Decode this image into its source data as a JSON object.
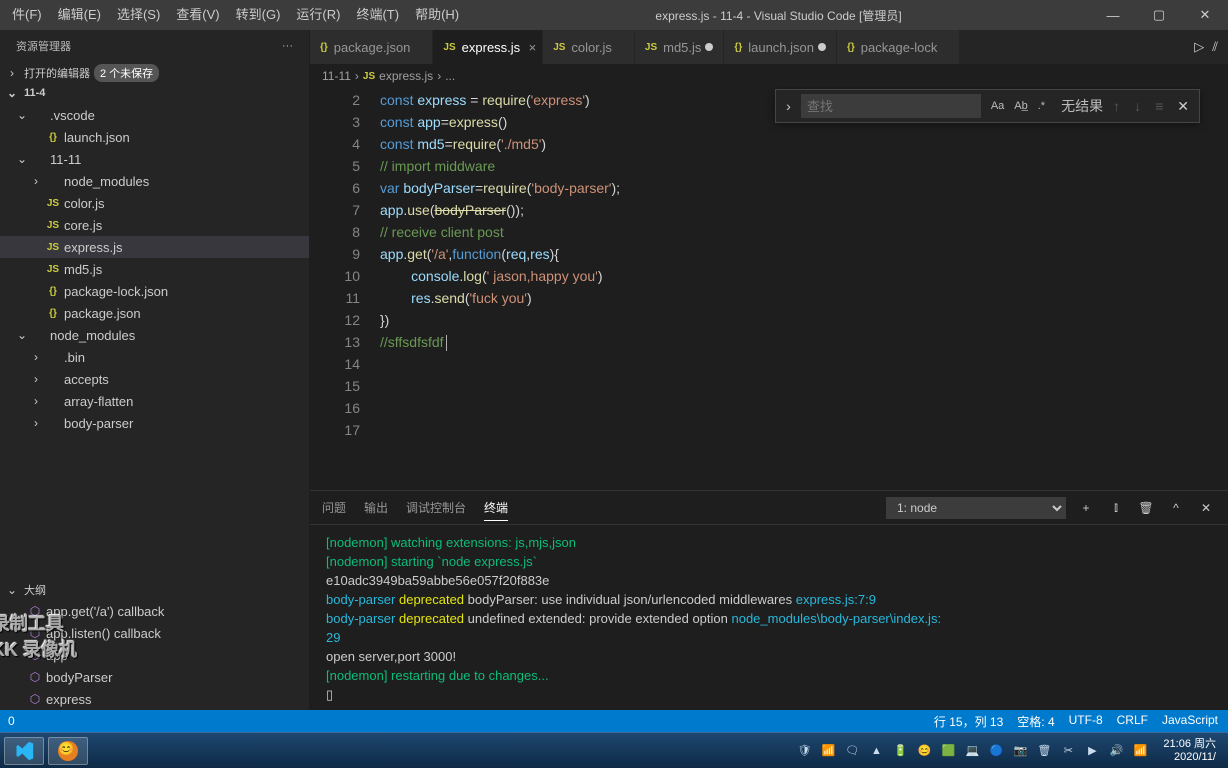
{
  "menu": [
    "件(F)",
    "编辑(E)",
    "选择(S)",
    "查看(V)",
    "转到(G)",
    "运行(R)",
    "终端(T)",
    "帮助(H)"
  ],
  "title": "express.js - 11-4 - Visual Studio Code [管理员]",
  "sidebar": {
    "header": "资源管理器",
    "openEditors": "打开的编辑器",
    "unsaved": "2 个未保存",
    "root": "11-4",
    "outline": "大纲",
    "tree": [
      {
        "t": "folder",
        "label": ".vscode",
        "chev": "v",
        "depth": 1
      },
      {
        "t": "json",
        "label": "launch.json",
        "depth": 2
      },
      {
        "t": "folder",
        "label": "11-11",
        "chev": "v",
        "depth": 1
      },
      {
        "t": "plain",
        "label": "node_modules",
        "chev": ">",
        "depth": 2
      },
      {
        "t": "js",
        "label": "color.js",
        "depth": 2
      },
      {
        "t": "js",
        "label": "core.js",
        "depth": 2
      },
      {
        "t": "js",
        "label": "express.js",
        "depth": 2,
        "active": true
      },
      {
        "t": "js",
        "label": "md5.js",
        "depth": 2
      },
      {
        "t": "json",
        "label": "package-lock.json",
        "depth": 2
      },
      {
        "t": "json",
        "label": "package.json",
        "depth": 2
      },
      {
        "t": "folder",
        "label": "node_modules",
        "chev": "v",
        "depth": 1
      },
      {
        "t": "plain",
        "label": ".bin",
        "chev": ">",
        "depth": 2
      },
      {
        "t": "plain",
        "label": "accepts",
        "chev": ">",
        "depth": 2
      },
      {
        "t": "plain",
        "label": "array-flatten",
        "chev": ">",
        "depth": 2
      },
      {
        "t": "plain",
        "label": "body-parser",
        "chev": ">",
        "depth": 2
      }
    ],
    "outlineItems": [
      {
        "label": "app.get('/a') callback"
      },
      {
        "label": "app.listen() callback"
      },
      {
        "label": "app"
      },
      {
        "label": "bodyParser"
      },
      {
        "label": "express"
      }
    ]
  },
  "tabs": [
    {
      "icon": "{}",
      "label": "package.json",
      "cls": "yellow"
    },
    {
      "icon": "JS",
      "label": "express.js",
      "cls": "yellow",
      "active": true,
      "close": true
    },
    {
      "icon": "JS",
      "label": "color.js",
      "cls": "yellow"
    },
    {
      "icon": "JS",
      "label": "md5.js",
      "cls": "yellow",
      "dirty": true
    },
    {
      "icon": "{}",
      "label": "launch.json",
      "cls": "yellow",
      "dirty": true
    },
    {
      "icon": "{}",
      "label": "package-lock",
      "cls": "yellow"
    }
  ],
  "breadcrumb": {
    "folder": "11-11",
    "file": "express.js",
    "fileIcon": "JS",
    "more": "..."
  },
  "find": {
    "placeholder": "查找",
    "noResult": "无结果",
    "opts": [
      "Aa",
      "Ab̲",
      ".*"
    ]
  },
  "code": {
    "start": 2,
    "lines": [
      [
        [
          "c-kw",
          "const "
        ],
        [
          "c-var",
          "express"
        ],
        [
          "",
          " = "
        ],
        [
          "c-fn",
          "require"
        ],
        [
          "",
          "("
        ],
        [
          "c-str",
          "'express'"
        ],
        [
          "",
          ")"
        ]
      ],
      [
        [
          "c-kw",
          "const "
        ],
        [
          "c-var",
          "app"
        ],
        [
          "",
          "="
        ],
        [
          "c-fn",
          "express"
        ],
        [
          "",
          "()"
        ]
      ],
      [
        [
          "c-kw",
          "const "
        ],
        [
          "c-var",
          "md5"
        ],
        [
          "",
          "="
        ],
        [
          "c-fn",
          "require"
        ],
        [
          "",
          "("
        ],
        [
          "c-str",
          "'./md5'"
        ],
        [
          "",
          ")"
        ]
      ],
      [
        [
          "c-cmt",
          "// import middware"
        ]
      ],
      [
        [
          "c-kw",
          "var "
        ],
        [
          "c-var",
          "bodyParser"
        ],
        [
          "",
          "="
        ],
        [
          "c-fn",
          "require"
        ],
        [
          "",
          "("
        ],
        [
          "c-str",
          "'body-parser'"
        ],
        [
          "",
          ");"
        ]
      ],
      [
        [
          "c-var",
          "app"
        ],
        [
          "",
          "."
        ],
        [
          "c-fn",
          "use"
        ],
        [
          "",
          "("
        ],
        [
          "c-fn line-through",
          "bodyParser"
        ],
        [
          "",
          "());"
        ]
      ],
      [
        [
          "",
          ""
        ]
      ],
      [
        [
          "c-cmt",
          "// receive client post"
        ]
      ],
      [
        [
          "c-var",
          "app"
        ],
        [
          "",
          "."
        ],
        [
          "c-fn",
          "get"
        ],
        [
          "",
          "("
        ],
        [
          "c-str",
          "'/a'"
        ],
        [
          "",
          ","
        ],
        [
          "c-kw",
          "function"
        ],
        [
          "",
          "("
        ],
        [
          "c-var",
          "req"
        ],
        [
          "",
          ","
        ],
        [
          "c-var",
          "res"
        ],
        [
          "",
          "){"
        ]
      ],
      [
        [
          "",
          "        "
        ],
        [
          "c-var",
          "console"
        ],
        [
          "",
          "."
        ],
        [
          "c-fn",
          "log"
        ],
        [
          "",
          "("
        ],
        [
          "c-str",
          "' jason,happy you'"
        ],
        [
          "",
          ")"
        ]
      ],
      [
        [
          "",
          "        "
        ],
        [
          "c-var",
          "res"
        ],
        [
          "",
          "."
        ],
        [
          "c-fn",
          "send"
        ],
        [
          "",
          "("
        ],
        [
          "c-str",
          "'fuck you'"
        ],
        [
          "",
          ")"
        ]
      ],
      [
        [
          "",
          ""
        ]
      ],
      [
        [
          "",
          "})"
        ]
      ],
      [
        [
          "c-cmt",
          "//sffsdfsfdf"
        ],
        [
          "",
          "cursor"
        ]
      ],
      [
        [
          "",
          ""
        ]
      ],
      [
        [
          "",
          ""
        ]
      ]
    ]
  },
  "panel": {
    "tabs": [
      "问题",
      "输出",
      "调试控制台",
      "终端"
    ],
    "activeTab": 3,
    "select": "1: node",
    "lines": [
      {
        "cls": "t-green",
        "text": "[nodemon] watching extensions: js,mjs,json"
      },
      {
        "cls": "t-green",
        "text": "[nodemon] starting `node express.js`"
      },
      {
        "cls": "t-white",
        "text": "e10adc3949ba59abbe56e057f20f883e"
      },
      {
        "segments": [
          [
            "t-cyan",
            "body-parser "
          ],
          [
            "t-yellow",
            "deprecated "
          ],
          [
            "t-white",
            "bodyParser: use individual json/urlencoded middlewares "
          ],
          [
            "t-cyan",
            "express.js:7:9"
          ]
        ]
      },
      {
        "segments": [
          [
            "t-cyan",
            "body-parser "
          ],
          [
            "t-yellow",
            "deprecated "
          ],
          [
            "t-white",
            "undefined extended: provide extended option "
          ],
          [
            "t-cyan",
            "node_modules\\body-parser\\index.js:"
          ]
        ]
      },
      {
        "cls": "t-cyan",
        "text": "29"
      },
      {
        "cls": "t-white",
        "text": "open server,port 3000!"
      },
      {
        "cls": "t-green",
        "text": "[nodemon] restarting due to changes..."
      },
      {
        "cls": "t-white",
        "text": "▯"
      }
    ]
  },
  "status": {
    "left": "0",
    "right": [
      "行 15，列 13",
      "空格: 4",
      "UTF-8",
      "CRLF",
      "JavaScript"
    ]
  },
  "taskbar": {
    "clock": {
      "time": "21:06",
      "date": "周六",
      "full": "2020/11/"
    }
  }
}
